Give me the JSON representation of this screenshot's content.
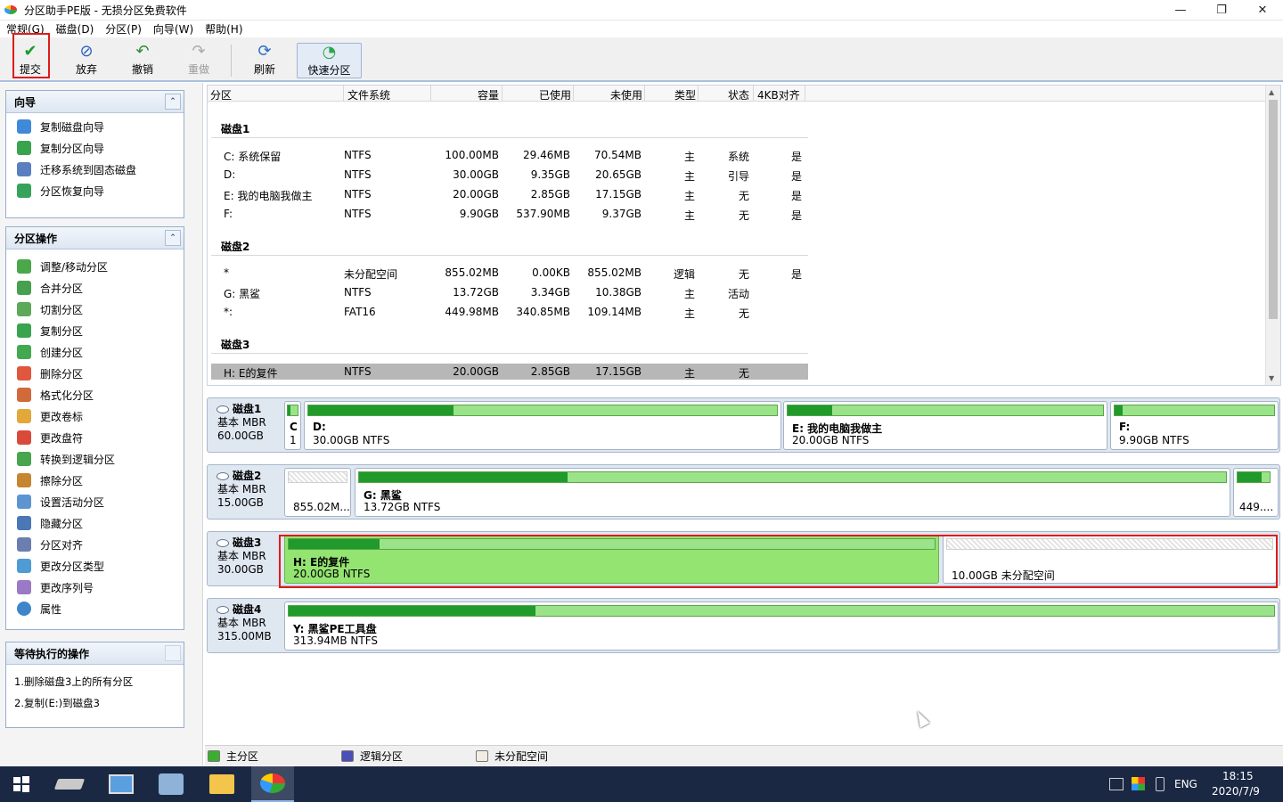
{
  "window": {
    "title": "分区助手PE版 - 无损分区免费软件",
    "minimize": "—",
    "maximize": "❐",
    "close": "✕"
  },
  "menu": [
    "常规(G)",
    "磁盘(D)",
    "分区(P)",
    "向导(W)",
    "帮助(H)"
  ],
  "toolbar": {
    "submit": "提交",
    "discard": "放弃",
    "undo": "撤销",
    "redo": "重做",
    "refresh": "刷新",
    "quick": "快速分区"
  },
  "wizard": {
    "title": "向导",
    "items": [
      "复制磁盘向导",
      "复制分区向导",
      "迁移系统到固态磁盘",
      "分区恢复向导"
    ]
  },
  "ops": {
    "title": "分区操作",
    "items": [
      "调整/移动分区",
      "合并分区",
      "切割分区",
      "复制分区",
      "创建分区",
      "删除分区",
      "格式化分区",
      "更改卷标",
      "更改盘符",
      "转换到逻辑分区",
      "擦除分区",
      "设置活动分区",
      "隐藏分区",
      "分区对齐",
      "更改分区类型",
      "更改序列号",
      "属性"
    ]
  },
  "pending": {
    "title": "等待执行的操作",
    "items": [
      "1.删除磁盘3上的所有分区",
      "2.复制(E:)到磁盘3"
    ]
  },
  "grid": {
    "headers": [
      "分区",
      "文件系统",
      "容量",
      "已使用",
      "未使用",
      "类型",
      "状态",
      "4KB对齐"
    ],
    "disks": [
      {
        "name": "磁盘1",
        "rows": [
          [
            "C: 系统保留",
            "NTFS",
            "100.00MB",
            "29.46MB",
            "70.54MB",
            "主",
            "系统",
            "是"
          ],
          [
            "D:",
            "NTFS",
            "30.00GB",
            "9.35GB",
            "20.65GB",
            "主",
            "引导",
            "是"
          ],
          [
            "E: 我的电脑我做主",
            "NTFS",
            "20.00GB",
            "2.85GB",
            "17.15GB",
            "主",
            "无",
            "是"
          ],
          [
            "F:",
            "NTFS",
            "9.90GB",
            "537.90MB",
            "9.37GB",
            "主",
            "无",
            "是"
          ]
        ]
      },
      {
        "name": "磁盘2",
        "rows": [
          [
            "*",
            "未分配空间",
            "855.02MB",
            "0.00KB",
            "855.02MB",
            "逻辑",
            "无",
            "是"
          ],
          [
            "G: 黑鲨",
            "NTFS",
            "13.72GB",
            "3.34GB",
            "10.38GB",
            "主",
            "活动",
            ""
          ],
          [
            "*:",
            "FAT16",
            "449.98MB",
            "340.85MB",
            "109.14MB",
            "主",
            "无",
            ""
          ]
        ]
      },
      {
        "name": "磁盘3",
        "rows": [
          [
            "H: E的复件",
            "NTFS",
            "20.00GB",
            "2.85GB",
            "17.15GB",
            "主",
            "无",
            ""
          ]
        ]
      }
    ]
  },
  "maps": [
    {
      "name": "磁盘1",
      "type": "基本 MBR",
      "size": "60.00GB",
      "parts": [
        {
          "label": "C",
          "sub": "1",
          "used": 0.3
        },
        {
          "label": "D:",
          "sub": "30.00GB NTFS",
          "used": 0.31
        },
        {
          "label": "E: 我的电脑我做主",
          "sub": "20.00GB NTFS",
          "used": 0.14
        },
        {
          "label": "F:",
          "sub": "9.90GB NTFS",
          "used": 0.05
        }
      ]
    },
    {
      "name": "磁盘2",
      "type": "基本 MBR",
      "size": "15.00GB",
      "parts": [
        {
          "label": "",
          "sub": "855.02M...",
          "used": 0
        },
        {
          "label": "G: 黑鲨",
          "sub": "13.72GB NTFS",
          "used": 0.24
        },
        {
          "label": "",
          "sub": "449....",
          "used": 0.76
        }
      ]
    },
    {
      "name": "磁盘3",
      "type": "基本 MBR",
      "size": "30.00GB",
      "parts": [
        {
          "label": "H: E的复件",
          "sub": "20.00GB NTFS",
          "used": 0.14
        },
        {
          "label": "",
          "sub": "10.00GB 未分配空间",
          "used": 0
        }
      ]
    },
    {
      "name": "磁盘4",
      "type": "基本 MBR",
      "size": "315.00MB",
      "parts": [
        {
          "label": "Y: 黑鲨PE工具盘",
          "sub": "313.94MB NTFS",
          "used": 0.25
        }
      ]
    }
  ],
  "legend": {
    "primary": "主分区",
    "logical": "逻辑分区",
    "unalloc": "未分配空间"
  },
  "colors": {
    "primary": "#3cae2f",
    "logical": "#4b4fb8",
    "unalloc": "#f1ede2",
    "highlight": "#e01b1b"
  },
  "tray": {
    "lang": "ENG",
    "time": "18:15",
    "date": "2020/7/9"
  }
}
